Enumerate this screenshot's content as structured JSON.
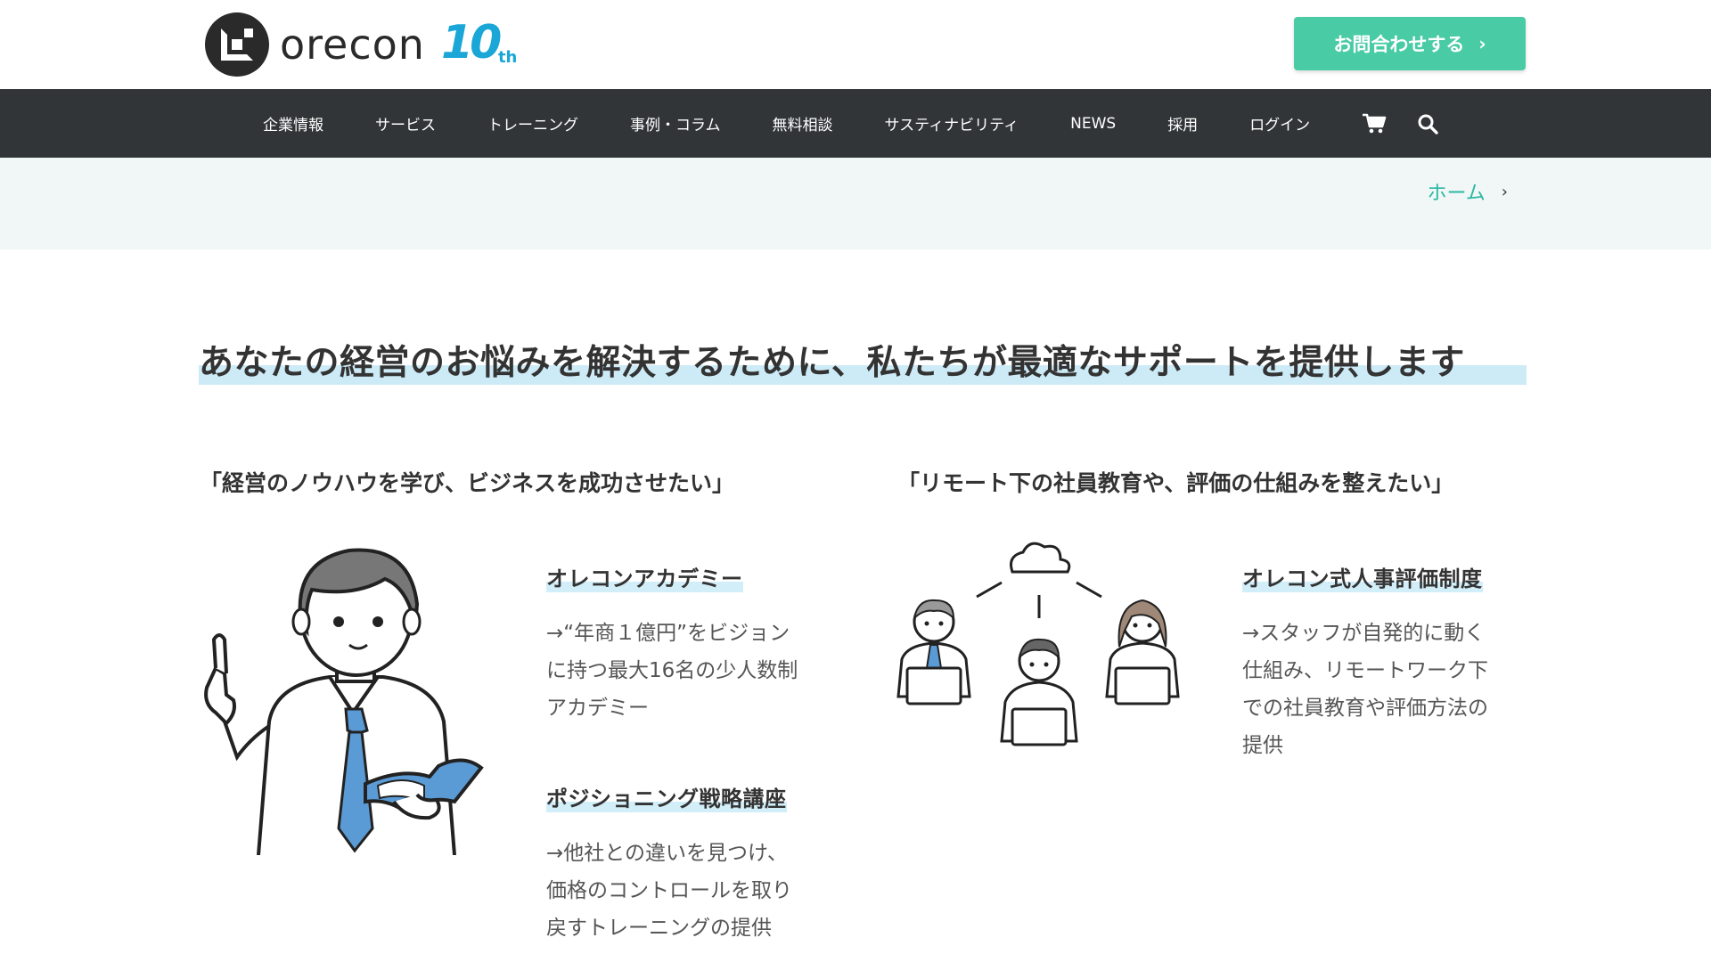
{
  "header": {
    "logo_text": "orecon",
    "anniversary_number": "10",
    "anniversary_suffix": "th",
    "contact_button": "お問合わせする",
    "contact_chevron": "›"
  },
  "nav": {
    "items": [
      "企業情報",
      "サービス",
      "トレーニング",
      "事例・コラム",
      "無料相談",
      "サスティナビリティ",
      "NEWS",
      "採用",
      "ログイン"
    ],
    "icons": [
      "cart-icon",
      "search-icon"
    ]
  },
  "breadcrumb": {
    "home": "ホーム",
    "chevron": "›"
  },
  "headline": "あなたの経営のお悩みを解決するために、私たちが最適なサポートを提供します",
  "sections": [
    {
      "title": "「経営のノウハウを学び、ビジネスを成功させたい」",
      "items": [
        {
          "title": "オレコンアカデミー",
          "desc_lines": [
            "→“年商１億円”をビジョン",
            "に持つ最大16名の少人数制",
            "アカデミー"
          ]
        },
        {
          "title": "ポジショニング戦略講座",
          "desc_lines": [
            "→他社との違いを見つけ、",
            "価格のコントロールを取り",
            "戻すトレーニングの提供"
          ]
        }
      ]
    },
    {
      "title": "「リモート下の社員教育や、評価の仕組みを整えたい」",
      "items": [
        {
          "title": "オレコン式人事評価制度",
          "desc_lines": [
            "→スタッフが自発的に動く",
            "仕組み、リモートワーク下",
            "での社員教育や評価方法の",
            "提供"
          ]
        }
      ]
    }
  ],
  "colors": {
    "accent_green": "#49cba5",
    "link_green": "#2bb8a2",
    "nav_bg": "#313537",
    "highlight_blue": "#cdebf7",
    "logo_blue": "#1aa6d6"
  }
}
